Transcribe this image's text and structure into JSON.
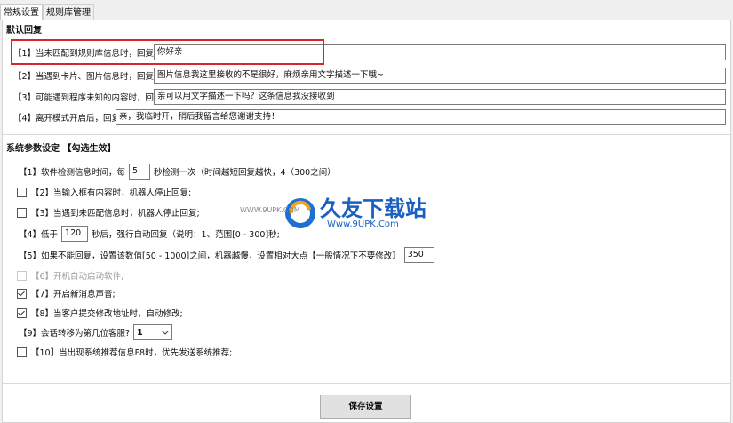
{
  "tabs": [
    "常规设置",
    "规则库管理"
  ],
  "default_reply": {
    "title": "默认回复",
    "rows": [
      {
        "label": "【1】当未匹配到规则库信息时，回复",
        "value": "你好亲"
      },
      {
        "label": "【2】当遇到卡片、图片信息时，回复",
        "value": "图片信息我这里接收的不是很好，麻烦亲用文字描述一下哦~"
      },
      {
        "label": "【3】可能遇到程序未知的内容时，回复",
        "value": "亲可以用文字描述一下吗？这条信息我没接收到"
      },
      {
        "label": "【4】离开模式开启后，回复",
        "value": "亲，我临时开，稍后我留言给您谢谢支持！"
      }
    ]
  },
  "system_params": {
    "title": "系统参数设定 【勾选生效】",
    "p1": {
      "prefix": "【1】软件检测信息时间，每",
      "value": "5",
      "suffix": "秒检测一次（时间越短回复越快，4（300之间）"
    },
    "p2": {
      "label": "【2】当输入框有内容时，机器人停止回复;",
      "checked": false
    },
    "p3": {
      "label": "【3】当遇到未匹配信息时，机器人停止回复;",
      "checked": false
    },
    "p4": {
      "prefix": "【4】低于",
      "value": "120",
      "suffix": "秒后，强行自动回复（说明：1、范围[0 - 300]秒;"
    },
    "p5": {
      "prefix": "【5】如果不能回复，设置该数值[50 - 1000]之间，机器越慢，设置相对大点【一般情况下不要修改】",
      "value": "350"
    },
    "p6": {
      "label": "【6】开机自动启动软件;",
      "checked": false,
      "disabled": true
    },
    "p7": {
      "label": "【7】开启新消息声音;",
      "checked": true
    },
    "p8": {
      "label": "【8】当客户提交修改地址时，自动修改;",
      "checked": true
    },
    "p9": {
      "label": "【9】会话转移为第几位客服?",
      "selected": "1"
    },
    "p10": {
      "label": "【10】当出现系统推荐信息F8时，优先发送系统推荐;",
      "checked": false
    }
  },
  "save_button": "保存设置",
  "watermark": {
    "text": "久友下载站",
    "url": "Www.9UPK.Com",
    "left_url": "WWW.9UPK.COM"
  }
}
